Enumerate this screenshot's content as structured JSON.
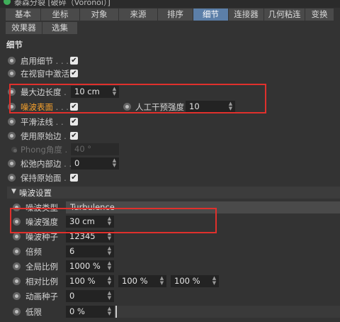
{
  "window": {
    "title": "泰森分裂 [破碎（Voronoi）]"
  },
  "tabs_row1": [
    "基本",
    "坐标",
    "对象",
    "来源",
    "排序",
    "细节",
    "连接器",
    "几何粘连",
    "变换"
  ],
  "tabs_row2": [
    "效果器",
    "选集"
  ],
  "active_tab": "细节",
  "section_title": "细节",
  "props": {
    "enable_detail": {
      "label": "启用细节",
      "dots": " . . . .",
      "checked": "✔"
    },
    "activate_in_viewport": {
      "label": "在视窗中激活",
      "checked": "✔"
    },
    "max_edge_length": {
      "label": "最大边长度",
      "dots": " .",
      "value": "10 cm"
    },
    "noise_surface": {
      "label": "噪波表面",
      "dots": " . . . .",
      "checked": "✔"
    },
    "manual_intensity": {
      "label": "人工干预强度",
      "value": "10"
    },
    "smooth_normals": {
      "label": "平滑法线",
      "dots": " . .",
      "checked": "✔"
    },
    "use_original_edges": {
      "label": "使用原始边",
      "dots": " . .",
      "checked": "✔"
    },
    "phong_angle": {
      "label": "Phong角度",
      "dots": " .",
      "value": "40 °"
    },
    "relax_inner": {
      "label": "松弛内部边",
      "dots": " . .",
      "value": "0"
    },
    "keep_original_faces": {
      "label": "保持原始面",
      "dots": " . .",
      "checked": "✔"
    }
  },
  "noise_group": {
    "title": "噪波设置",
    "noise_type": {
      "label": "噪波类型",
      "value": "Turbulence"
    },
    "noise_strength": {
      "label": "噪波强度",
      "value": "30 cm"
    },
    "noise_seed": {
      "label": "噪波种子",
      "value": "12345"
    },
    "octaves": {
      "label": "倍频",
      "value": "6"
    },
    "global_scale": {
      "label": "全局比例",
      "value": "1000 %"
    },
    "relative_scale": {
      "label": "相对比例",
      "values": [
        "100 %",
        "100 %",
        "100 %"
      ]
    },
    "anim_seed": {
      "label": "动画种子",
      "value": "0"
    },
    "low_clip": {
      "label": "低限",
      "value": "0 %"
    }
  },
  "colors": {
    "active_tab": "#5c7fa8",
    "highlight_label": "#f5a02c",
    "annotation": "#e0302c"
  }
}
